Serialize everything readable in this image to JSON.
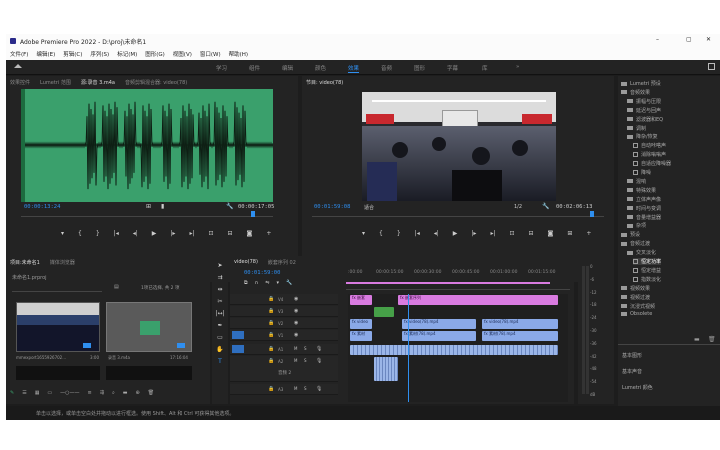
{
  "app": {
    "title": "Adobe Premiere Pro 2022 - D:\\proj\\未命名1",
    "win_min": "–",
    "win_max": "▢",
    "win_close": "✕"
  },
  "menu": [
    "文件(F)",
    "编辑(E)",
    "剪辑(C)",
    "序列(S)",
    "标记(M)",
    "图形(G)",
    "视图(V)",
    "窗口(W)",
    "帮助(H)"
  ],
  "workspaces": [
    "学习",
    "组件",
    "编辑",
    "颜色",
    "效果",
    "音频",
    "图形",
    "字幕",
    "库"
  ],
  "source": {
    "tabs": [
      "效果控件",
      "Lumetri 范围",
      "源:录音 3.m4a",
      "音频剪辑混合器: video(78)"
    ],
    "tc_in": "00:00:13:24",
    "tc_dur": "00:00:17:05",
    "colors": {
      "wave_bg": "#3aa06c",
      "wave": "#0e1f14"
    }
  },
  "program": {
    "tab": "节目: video(78)",
    "tc_in": "00:01:59:08",
    "fit": "适合",
    "ratio": "1/2",
    "tc_dur": "00:02:06:13"
  },
  "project": {
    "tabs": [
      "项目:未命名1",
      "媒体浏览器"
    ],
    "file": "未命名1.prproj",
    "sel": "1项已选择, 共 2 项",
    "items": [
      {
        "name": "mmexport1655926702...",
        "dur": "3:00"
      },
      {
        "name": "录音 3.m4a",
        "dur": "17:16:04"
      }
    ]
  },
  "timeline": {
    "tabs": [
      "video(78)",
      "嵌套序列 02"
    ],
    "tc": "00:01:59:00",
    "ruler": [
      ":00:00",
      "00:00:15:00",
      "00:00:30:00",
      "00:00:45:00",
      "00:01:00:00",
      "00:01:15:00"
    ],
    "tracks": [
      "V4",
      "V3",
      "V2",
      "V1",
      "A1",
      "A2",
      "A3"
    ],
    "mix": "音频 2",
    "clips": {
      "v4a": "fx 嵌套",
      "v4b": "fx 嵌套序列",
      "v2a": "fx video",
      "v2b": "fx video(78).mp4",
      "v2c": "fx video(78).mp4",
      "v1a": "fx 素材",
      "v1b": "fx 素材(78).mp4",
      "v1c": "fx 素材(78).mp4"
    }
  },
  "effects": {
    "tree": [
      "Lumetri 预设",
      "音频效果",
      "振幅与压限",
      "延迟与回声",
      "滤波器和EQ",
      "调制",
      "降杂/恢复",
      "自动咔嗒声",
      "消除嗡嗡声",
      "自适应降噪器",
      "降噪",
      "混响",
      "特殊效果",
      "立体声声像",
      "时间与变调",
      "音量增益器",
      "杂项",
      "预设",
      "音频过渡",
      "交叉淡化",
      "恒定功率",
      "恒定增益",
      "指数淡化",
      "视频效果",
      "视频过渡",
      "沉浸式视频",
      "Obsolete"
    ],
    "bottom": [
      "基本图形",
      "基本声音",
      "Lumetri 颜色"
    ]
  },
  "meter_scale": [
    "0",
    "-6",
    "-12",
    "-18",
    "-24",
    "-30",
    "-36",
    "-42",
    "-48",
    "-54",
    "dB"
  ],
  "status": "单击以选择，或单击空白处并拖动以进行框选。使用 Shift、Alt 和 Ctrl 可获得其他选项。"
}
